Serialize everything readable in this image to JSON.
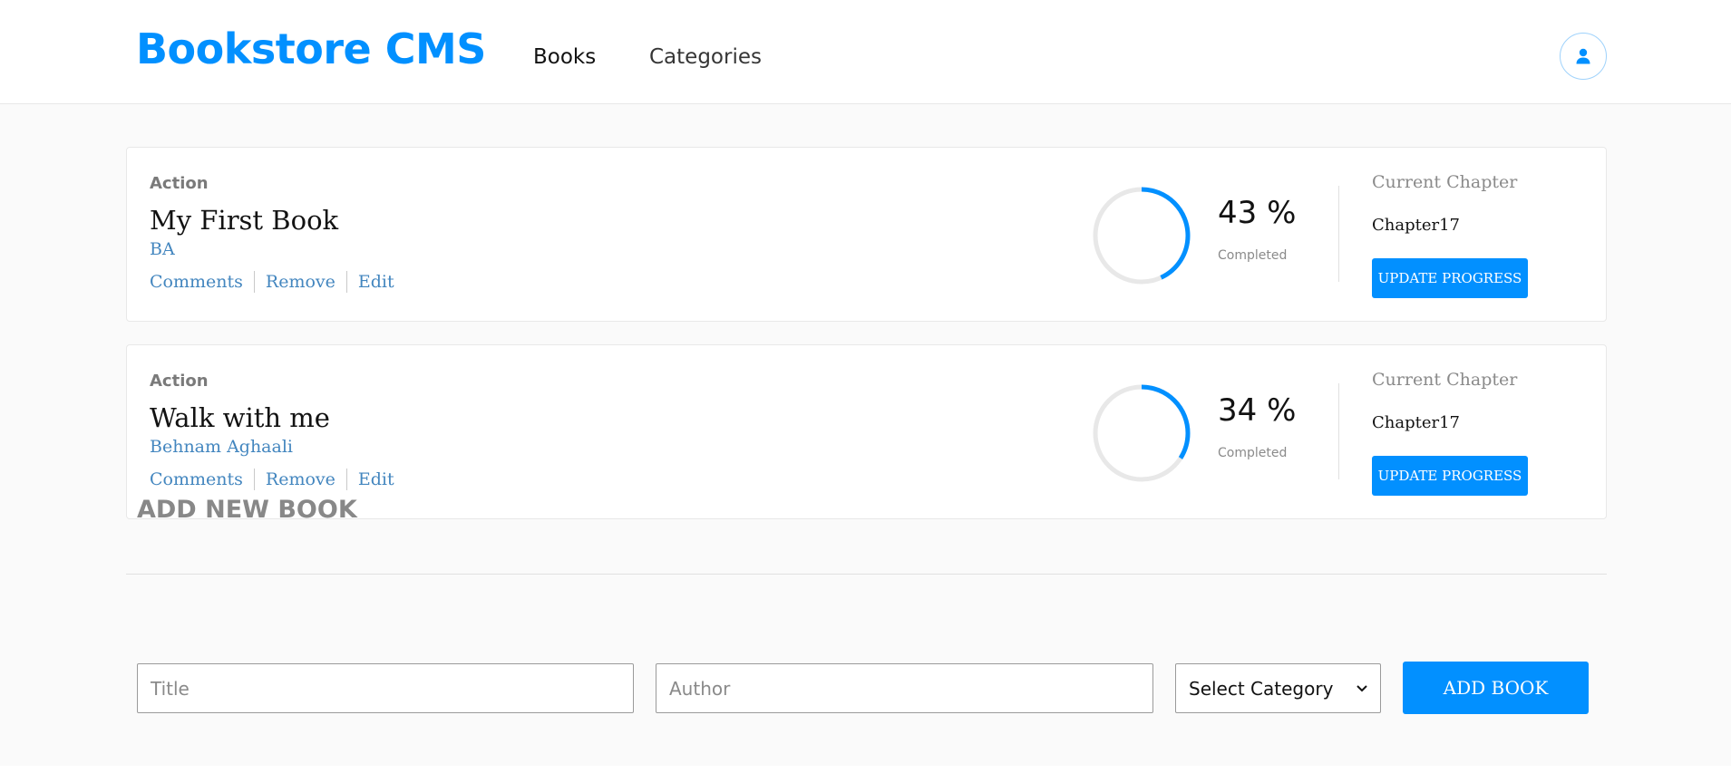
{
  "header": {
    "brand": "Bookstore CMS",
    "nav": {
      "books": "Books",
      "categories": "Categories"
    },
    "profile_icon": "user-icon"
  },
  "books": [
    {
      "genre": "Action",
      "title": "My First Book",
      "author": "BA",
      "actions": {
        "comments": "Comments",
        "remove": "Remove",
        "edit": "Edit"
      },
      "progress_percent": 43,
      "percent_label": "43 %",
      "completed_label": "Completed",
      "chapter_label": "Current Chapter",
      "chapter": "Chapter17",
      "update_label": "UPDATE PROGRESS"
    },
    {
      "genre": "Action",
      "title": "Walk with me",
      "author": "Behnam Aghaali",
      "actions": {
        "comments": "Comments",
        "remove": "Remove",
        "edit": "Edit"
      },
      "progress_percent": 34,
      "percent_label": "34 %",
      "completed_label": "Completed",
      "chapter_label": "Current Chapter",
      "chapter": "Chapter17",
      "update_label": "UPDATE PROGRESS"
    }
  ],
  "add_book": {
    "heading": "ADD NEW BOOK",
    "title_placeholder": "Title",
    "author_placeholder": "Author",
    "category_selected": "Select Category",
    "submit_label": "ADD BOOK"
  },
  "colors": {
    "accent": "#0290ff",
    "author_link": "#4386bf",
    "ring_track": "#e8e8e8"
  }
}
